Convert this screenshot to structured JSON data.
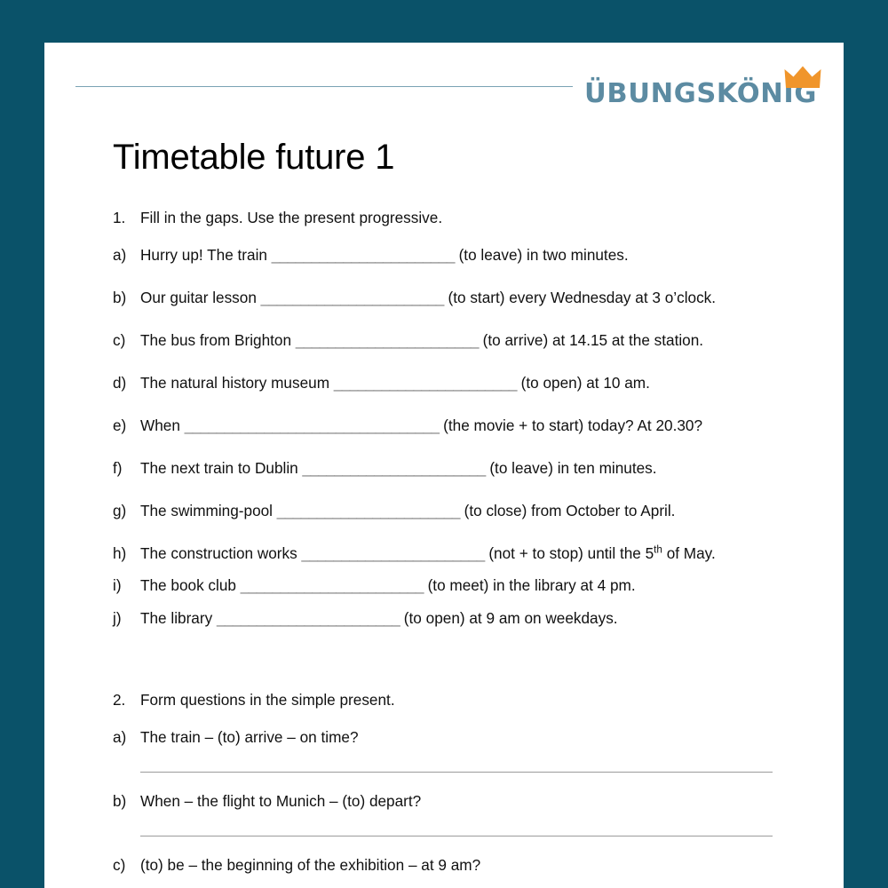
{
  "colors": {
    "page_background": "#0a5269",
    "sheet": "#ffffff",
    "logo_text": "#5c8ba2",
    "logo_crown": "#f0952b",
    "header_rule": "#7aa3b4",
    "blank_line": "#7c7c7c",
    "answer_line": "#9b9b9b",
    "body_text": "#111111"
  },
  "header": {
    "rule": "horizontal-rule",
    "logo_text": "ÜBUNGSKÖNIG",
    "crown_icon": "crown-icon"
  },
  "title": "Timetable future 1",
  "exercises": [
    {
      "number": "1.",
      "instruction": "Fill in the gaps. Use the present progressive.",
      "items": [
        {
          "marker": "a)",
          "before": "Hurry up! The train ",
          "blank": "_______________________",
          "after": " (to leave) in two minutes."
        },
        {
          "marker": "b)",
          "before": "Our guitar lesson ",
          "blank": "_______________________",
          "after": " (to start) every Wednesday at 3 o’clock."
        },
        {
          "marker": "c)",
          "before": "The bus from Brighton ",
          "blank": "_______________________",
          "after": " (to arrive) at 14.15 at the station."
        },
        {
          "marker": "d)",
          "before": "The natural history museum ",
          "blank": "_______________________",
          "after": " (to open) at 10 am."
        },
        {
          "marker": "e)",
          "before": "When ",
          "blank": "________________________________",
          "after": " (the movie + to start) today? At 20.30?"
        },
        {
          "marker": "f)",
          "before": "The next train to Dublin ",
          "blank": "_______________________",
          "after": " (to leave) in ten minutes."
        },
        {
          "marker": "g)",
          "before": "The swimming-pool ",
          "blank": "_______________________",
          "after": " (to close) from October to April."
        },
        {
          "marker": "h)",
          "before": "The construction works ",
          "blank": "_______________________",
          "after_1": " (not + to stop) until the 5",
          "sup": "th",
          "after_2": " of May."
        },
        {
          "marker": "i)",
          "before": "The book club ",
          "blank": "_______________________",
          "after": " (to meet) in the library at 4 pm."
        },
        {
          "marker": "j)",
          "before": "The library ",
          "blank": "_______________________",
          "after": " (to open) at 9 am on weekdays."
        }
      ]
    },
    {
      "number": "2.",
      "instruction": "Form questions in the simple present.",
      "items": [
        {
          "marker": "a)",
          "text": "The train – (to) arrive – on time?"
        },
        {
          "marker": "b)",
          "text": "When – the flight to Munich – (to) depart?"
        },
        {
          "marker": "c)",
          "text": "(to) be – the beginning of the exhibition – at 9 am?"
        }
      ]
    }
  ]
}
